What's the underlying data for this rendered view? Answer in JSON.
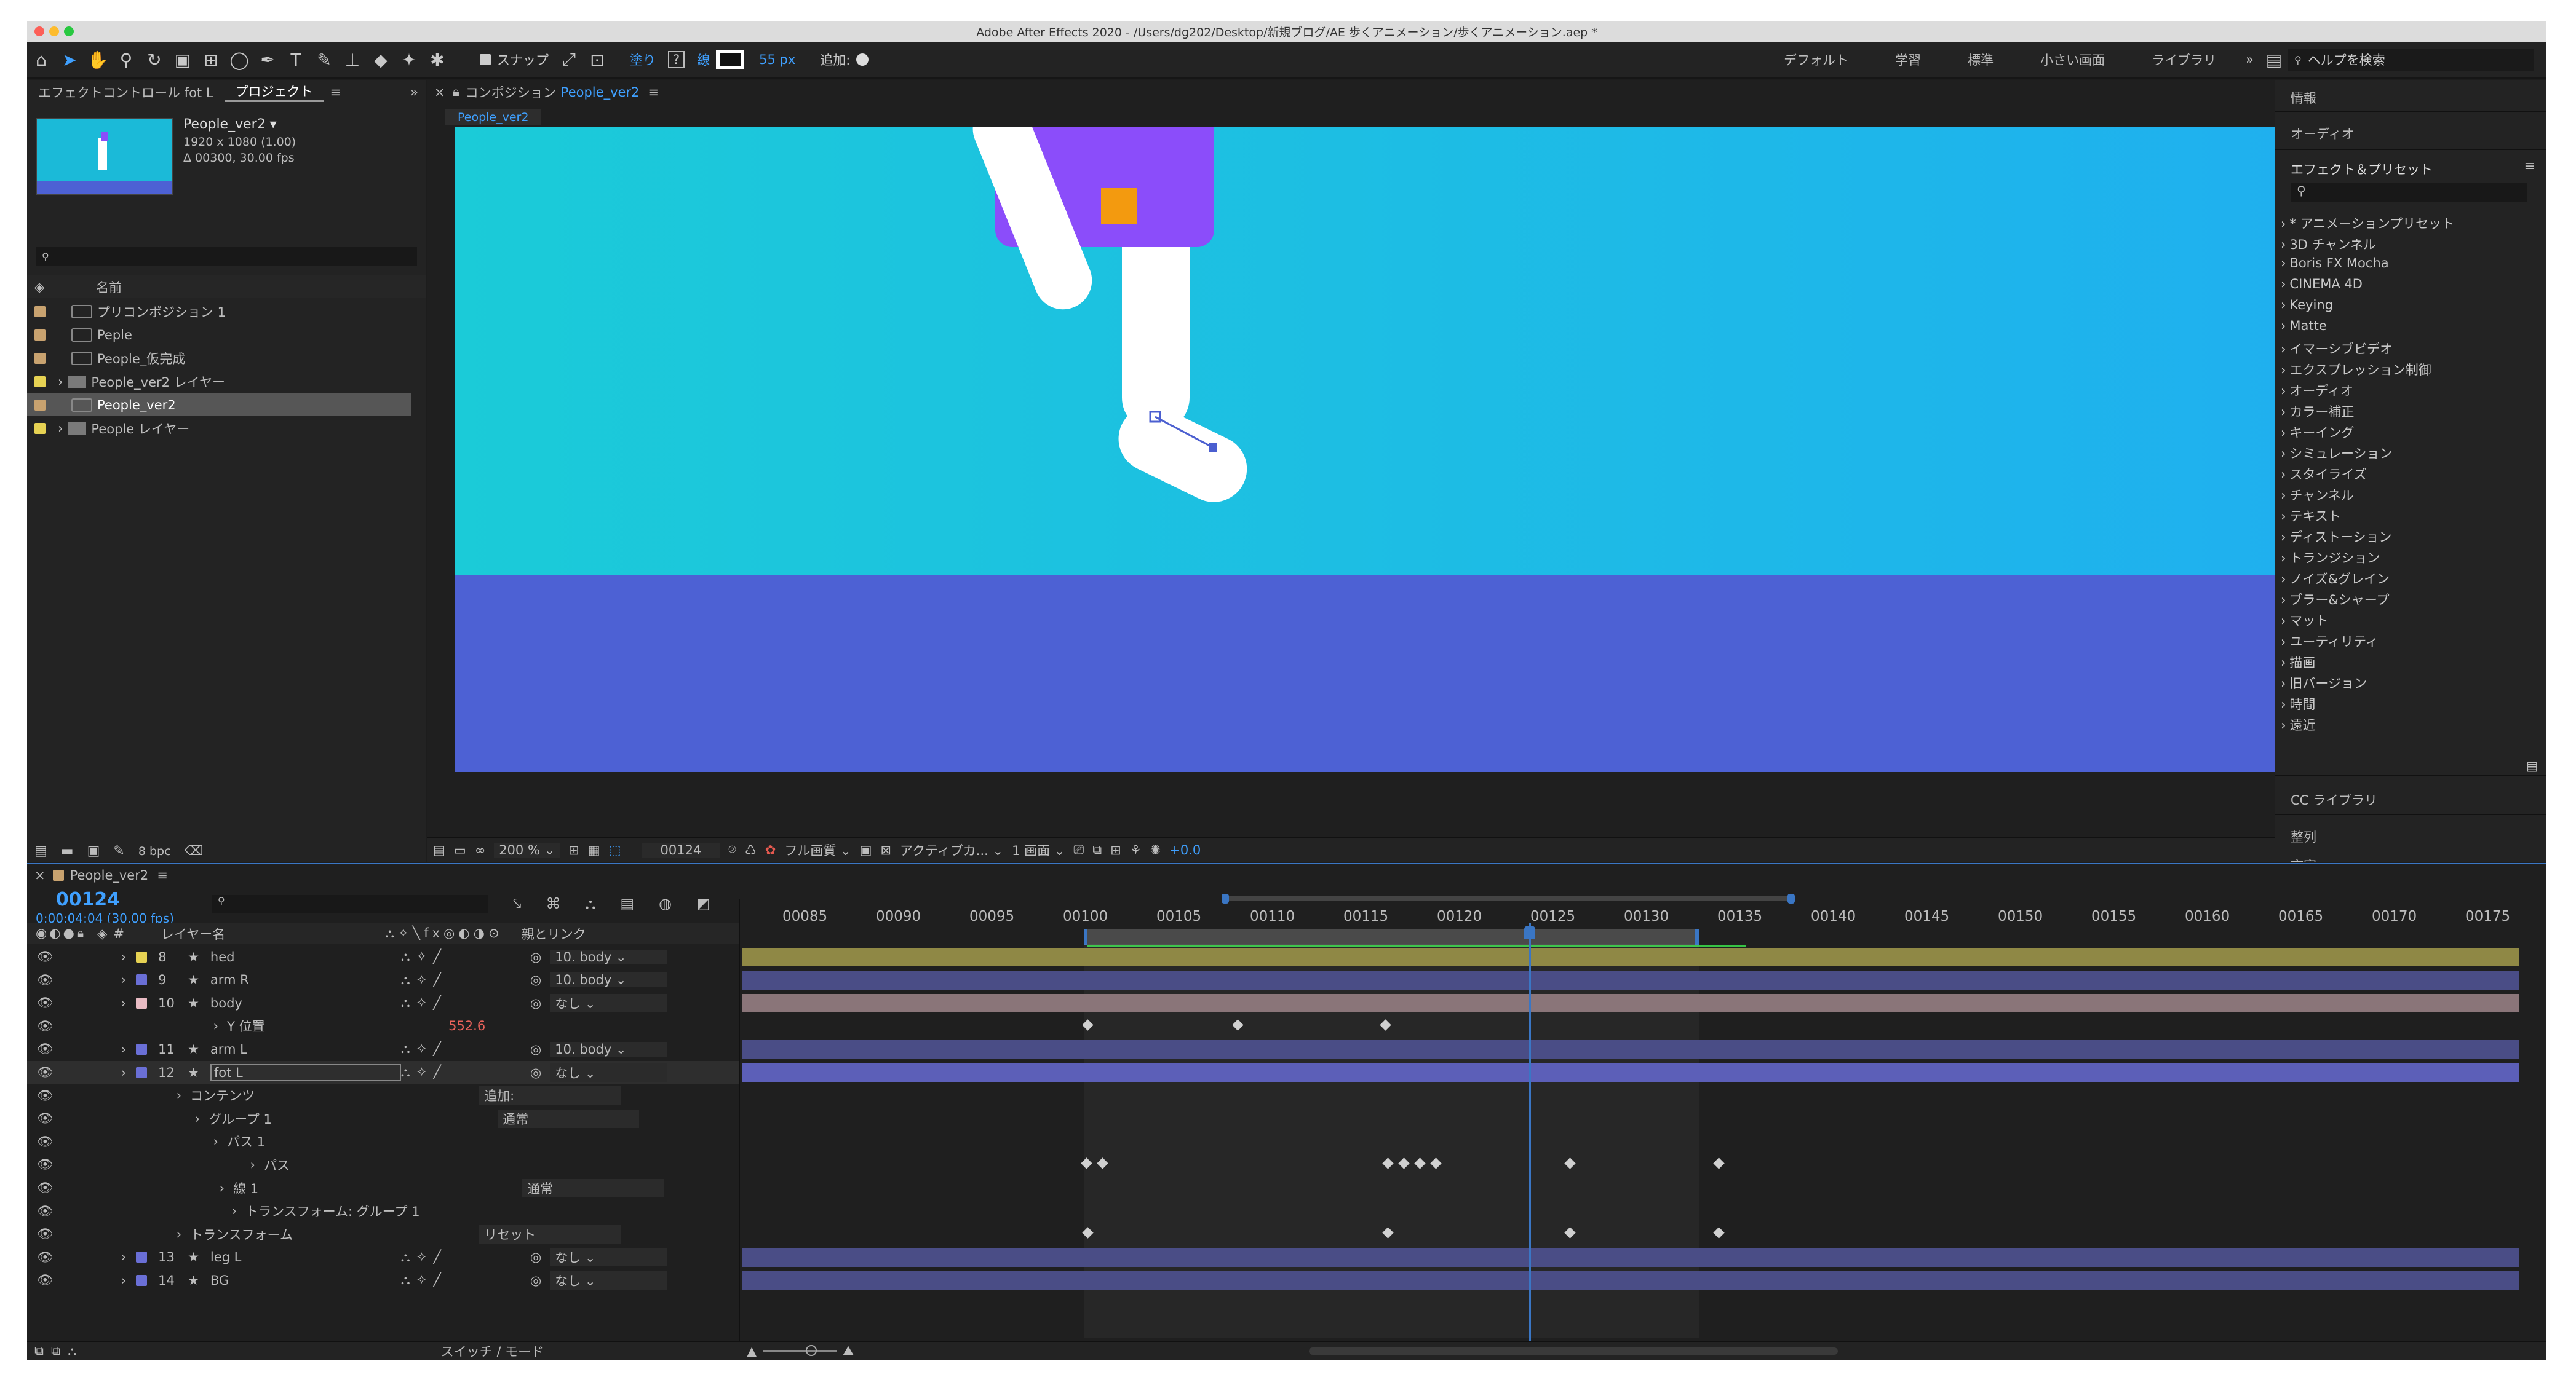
{
  "window": {
    "title": "Adobe After Effects 2020 - /Users/dg202/Desktop/新規ブログ/AE 歩くアニメーション/歩くアニメーション.aep *"
  },
  "toolbar": {
    "snap_label": "スナップ",
    "fill_label": "塗り",
    "fill_value": "?",
    "stroke_label": "線",
    "stroke_px": "55 px",
    "add_label": "追加:",
    "workspaces": [
      "デフォルト",
      "学習",
      "標準",
      "小さい画面",
      "ライブラリ"
    ],
    "more": "»",
    "help_placeholder": "ヘルプを検索"
  },
  "project": {
    "tabs": [
      "エフェクトコントロール fot L",
      "プロジェクト"
    ],
    "comp_name": "People_ver2 ▾",
    "comp_size": "1920 x 1080 (1.00)",
    "comp_dur": "Δ 00300, 30.00 fps",
    "name_col": "名前",
    "items": [
      {
        "name": "プリコンポジション 1",
        "color": "#c8a26f",
        "kind": "comp"
      },
      {
        "name": "Peple",
        "color": "#c8a26f",
        "kind": "comp"
      },
      {
        "name": "People_仮完成",
        "color": "#c8a26f",
        "kind": "comp"
      },
      {
        "name": "People_ver2 レイヤー",
        "color": "#e6d253",
        "kind": "folder"
      },
      {
        "name": "People_ver2",
        "color": "#c8a26f",
        "kind": "comp"
      },
      {
        "name": "People レイヤー",
        "color": "#e6d253",
        "kind": "folder"
      }
    ],
    "bpc": "8 bpc"
  },
  "comp": {
    "tab_label": "コンポジション",
    "tab_name": "People_ver2",
    "sub_tab": "People_ver2",
    "zoom": "200 %",
    "frame": "00124",
    "quality": "フル画質",
    "camera": "アクティブカ...",
    "views": "1 画面",
    "exposure": "+0.0"
  },
  "right": {
    "info": "情報",
    "audio": "オーディオ",
    "effects_title": "エフェクト＆プリセット",
    "effects": [
      "* アニメーションプリセット",
      "3D チャンネル",
      "Boris FX Mocha",
      "CINEMA 4D",
      "Keying",
      "Matte",
      "イマーシブビデオ",
      "エクスプレッション制御",
      "オーディオ",
      "カラー補正",
      "キーイング",
      "シミュレーション",
      "スタイライズ",
      "チャンネル",
      "テキスト",
      "ディストーション",
      "トランジション",
      "ノイズ&グレイン",
      "ブラー&シャープ",
      "マット",
      "ユーティリティ",
      "描画",
      "旧バージョン",
      "時間",
      "遠近"
    ],
    "cc_libraries": "CC ライブラリ",
    "align": "整列",
    "text": "文字"
  },
  "timeline": {
    "tab": "People_ver2",
    "timecode": "00124",
    "time_sub": "0:00:04:04 (30.00 fps)",
    "col_layer": "レイヤー名",
    "col_parent": "親とリンク",
    "footer_mode": "スイッチ / モード",
    "ruler": [
      "00085",
      "00090",
      "00095",
      "00100",
      "00105",
      "00110",
      "00115",
      "00120",
      "00125",
      "00130",
      "00135",
      "00140",
      "00145",
      "00150",
      "00155",
      "00160",
      "00165",
      "00170",
      "00175"
    ],
    "rows": [
      {
        "num": "8",
        "name": "hed",
        "color": "#e6d253",
        "parent": "10. body",
        "bar": "#8f8845"
      },
      {
        "num": "9",
        "name": "arm R",
        "color": "#6a6fd6",
        "parent": "10. body",
        "bar": "#4a4d86"
      },
      {
        "num": "10",
        "name": "body",
        "color": "#e9bcc4",
        "parent": "なし",
        "bar": "#8a7579"
      },
      {
        "num": "",
        "name": "Y 位置",
        "color": "",
        "parent": "",
        "value": "552.6",
        "bar": ""
      },
      {
        "num": "11",
        "name": "arm L",
        "color": "#6a6fd6",
        "parent": "10. body",
        "bar": "#4a4d86"
      },
      {
        "num": "12",
        "name": "fot L",
        "color": "#6a6fd6",
        "parent": "なし",
        "bar": "#5c5fb8"
      },
      {
        "num": "",
        "name": "コンテンツ",
        "color": "",
        "parent": "追加:",
        "bar": ""
      },
      {
        "num": "",
        "name": "グループ 1",
        "color": "",
        "parent": "通常",
        "bar": ""
      },
      {
        "num": "",
        "name": "パス 1",
        "color": "",
        "parent": "",
        "bar": ""
      },
      {
        "num": "",
        "name": "パス",
        "color": "",
        "parent": "",
        "bar": ""
      },
      {
        "num": "",
        "name": "線 1",
        "color": "",
        "parent": "通常",
        "bar": ""
      },
      {
        "num": "",
        "name": "トランスフォーム: グループ 1",
        "color": "",
        "parent": "",
        "bar": ""
      },
      {
        "num": "",
        "name": "トランスフォーム",
        "color": "",
        "parent": "リセット",
        "bar": ""
      },
      {
        "num": "13",
        "name": "leg L",
        "color": "#6a6fd6",
        "parent": "なし",
        "bar": "#4a4d86"
      },
      {
        "num": "14",
        "name": "BG",
        "color": "#6a6fd6",
        "parent": "なし",
        "bar": "#4a4d86"
      }
    ]
  }
}
